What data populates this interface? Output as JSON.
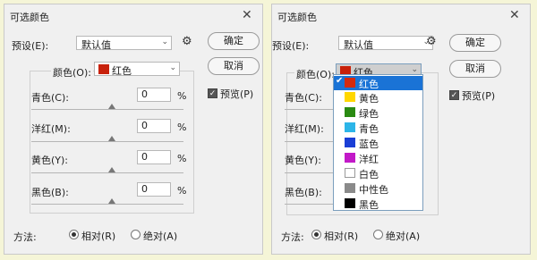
{
  "dialog": {
    "title": "可选颜色",
    "preset_label": "预设(E):",
    "preset_value": "默认值",
    "ok_label": "确定",
    "cancel_label": "取消",
    "preview_label": "预览(P)",
    "color_label": "颜色(O):",
    "color_value": "红色",
    "sliders": [
      {
        "label": "青色(C):",
        "value": "0",
        "unit": "%"
      },
      {
        "label": "洋红(M):",
        "value": "0",
        "unit": "%"
      },
      {
        "label": "黄色(Y):",
        "value": "0",
        "unit": "%"
      },
      {
        "label": "黑色(B):",
        "value": "0",
        "unit": "%"
      }
    ],
    "method_label": "方法:",
    "method_relative": "相对(R)",
    "method_absolute": "绝对(A)"
  },
  "dropdown_options": [
    {
      "label": "红色",
      "color": "#d42a0f",
      "selected": true
    },
    {
      "label": "黄色",
      "color": "#ffd700"
    },
    {
      "label": "绿色",
      "color": "#2a8a12"
    },
    {
      "label": "青色",
      "color": "#2cb5e8"
    },
    {
      "label": "蓝色",
      "color": "#1a3fd6"
    },
    {
      "label": "洋红",
      "color": "#c219c8"
    },
    {
      "label": "白色",
      "color": "#ffffff"
    },
    {
      "label": "中性色",
      "color": "#8a8a8a"
    },
    {
      "label": "黑色",
      "color": "#000000"
    }
  ],
  "colors": {
    "accent": "#1a73d6",
    "red_swatch": "#c8210b"
  }
}
